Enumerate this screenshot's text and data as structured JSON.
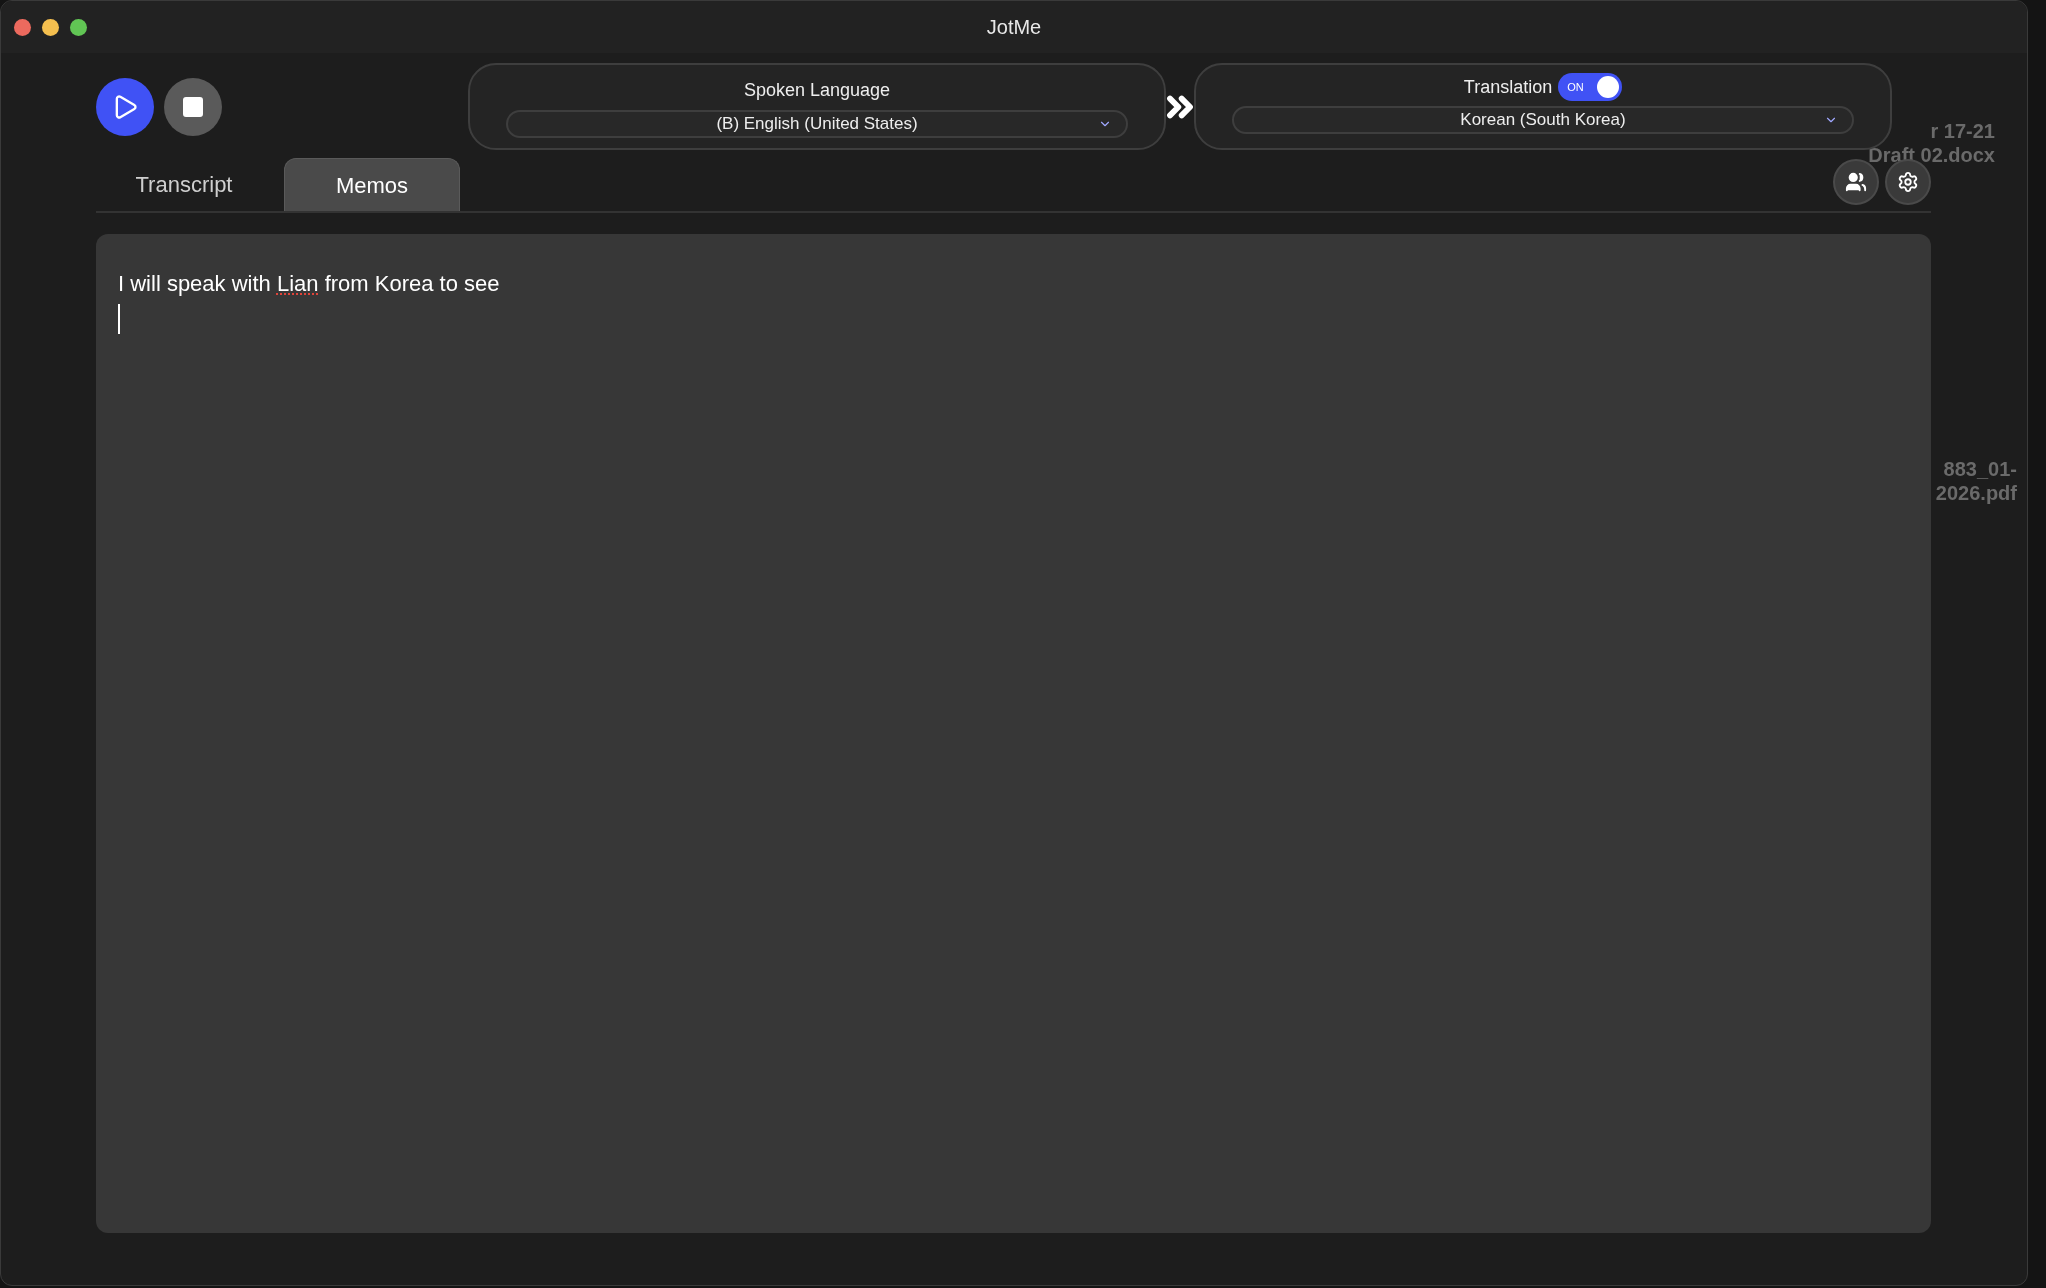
{
  "window": {
    "title": "JotMe"
  },
  "desktop_files": [
    {
      "lines": [
        "r 17-21",
        "Draft 02.docx"
      ]
    },
    {
      "lines": [
        "883_01-",
        "2026.pdf"
      ]
    }
  ],
  "spoken_language": {
    "label": "Spoken Language",
    "value": "(B) English (United States)"
  },
  "translation": {
    "label": "Translation",
    "on": true,
    "switch_text": "ON",
    "value": "Korean (South Korea)"
  },
  "tabs": [
    {
      "label": "Transcript",
      "selected": false
    },
    {
      "label": "Memos",
      "selected": true
    }
  ],
  "memo": {
    "segments": [
      {
        "text": "I will speak with ",
        "misspelled": false
      },
      {
        "text": "Lian",
        "misspelled": true
      },
      {
        "text": " from Korea to see",
        "misspelled": false
      }
    ]
  }
}
